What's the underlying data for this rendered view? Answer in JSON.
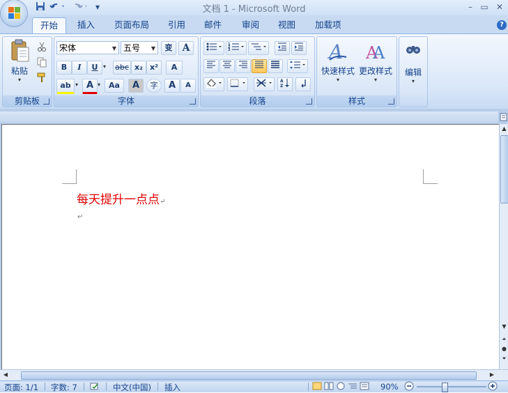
{
  "window": {
    "title": "文档 1 - Microsoft Word",
    "minimize_glyph": "–",
    "restore_glyph": "▭",
    "close_glyph": "✕",
    "help_glyph": "?"
  },
  "quick_access": {
    "save_icon": "floppy-disk-icon",
    "undo_icon": "undo-icon",
    "redo_icon": "redo-icon",
    "customize_glyph": "▾"
  },
  "tabs": [
    "开始",
    "插入",
    "页面布局",
    "引用",
    "邮件",
    "审阅",
    "视图",
    "加载项"
  ],
  "active_tab": "开始",
  "ribbon": {
    "clipboard": {
      "label": "剪贴板",
      "paste_label": "粘贴"
    },
    "font": {
      "label": "字体",
      "font_name": "宋体",
      "font_size": "五号",
      "pinyin_glyph": "变",
      "border_glyph": "A",
      "bold": "B",
      "italic": "I",
      "underline": "U",
      "strike": "abc",
      "subscript": "x₂",
      "superscript": "x²",
      "clear_glyph": "A",
      "highlight_glyph": "ab",
      "color_glyph": "A",
      "case_glyph": "Aa",
      "shade_glyph": "A",
      "enclose_glyph": "字",
      "grow_glyph": "A",
      "shrink_glyph": "A"
    },
    "paragraph": {
      "label": "段落"
    },
    "styles": {
      "label": "样式",
      "quick_styles": "快速样式",
      "change_styles": "更改样式"
    },
    "editing": {
      "label": "编辑"
    }
  },
  "document": {
    "line1": "每天提升一点点",
    "text_color": "#e00000"
  },
  "status": {
    "page": "页面: 1/1",
    "words": "字数: 7",
    "language": "中文(中国)",
    "mode": "插入",
    "zoom": "90%"
  }
}
